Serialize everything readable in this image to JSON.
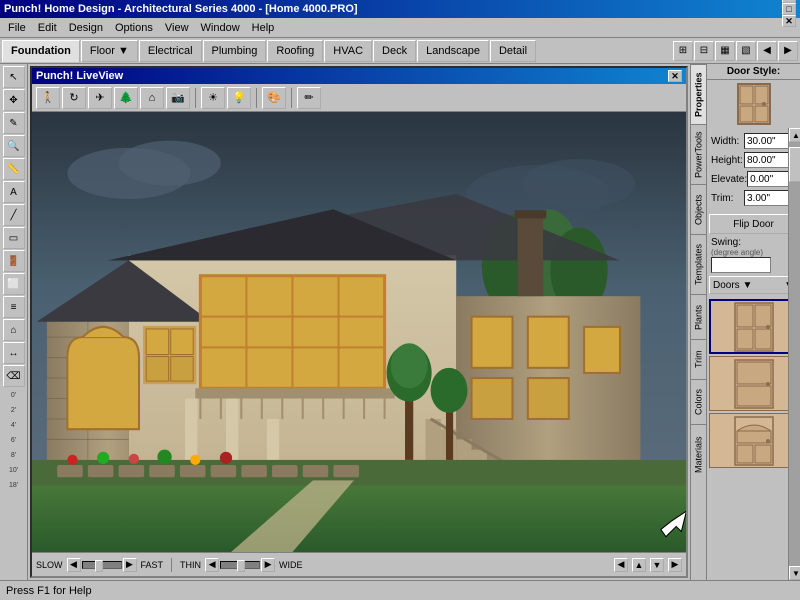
{
  "titleBar": {
    "title": "Punch! Home Design - Architectural Series 4000 - [Home 4000.PRO]",
    "controls": [
      "─",
      "□",
      "✕"
    ]
  },
  "menuBar": {
    "items": [
      "File",
      "Edit",
      "Design",
      "Options",
      "View",
      "Window",
      "Help"
    ]
  },
  "tabs": {
    "items": [
      "Foundation",
      "Floor ▼",
      "Electrical",
      "Plumbing",
      "Roofing",
      "HVAC",
      "Deck",
      "Landscape",
      "Detail"
    ],
    "active": "Foundation"
  },
  "liveview": {
    "title": "Punch! LiveView",
    "toolbar": {
      "tools": [
        "🚶",
        "🔄",
        "🌿",
        "🏠",
        "📐",
        "✏️",
        "🌤️",
        "💡",
        "🎨",
        "✏"
      ]
    },
    "bottom": {
      "slow": "SLOW",
      "fast": "FAST",
      "thin": "THIN",
      "wide": "WIDE"
    }
  },
  "properties": {
    "title": "Door Style:",
    "fields": [
      {
        "label": "Width:",
        "value": "30.00\""
      },
      {
        "label": "Height:",
        "value": "80.00\""
      },
      {
        "label": "Elevate:",
        "value": "0.00\""
      },
      {
        "label": "Trim:",
        "value": "3.00\""
      }
    ],
    "flipDoorLabel": "Flip Door",
    "swingLabel": "Swing:",
    "swingNote": "(degree angle)"
  },
  "rightTabs": {
    "items": [
      "Properties",
      "PowerTools",
      "Objects",
      "Templates",
      "Plants",
      "Trim",
      "Colors",
      "Materials"
    ]
  },
  "doorDropdown": {
    "label": "Doors ▼"
  },
  "statusBar": {
    "text": "Press F1 for Help"
  },
  "cornerIcons": {
    "items": [
      "⊞",
      "⊟",
      "⊠",
      "⊡",
      "◀",
      "▶"
    ]
  }
}
